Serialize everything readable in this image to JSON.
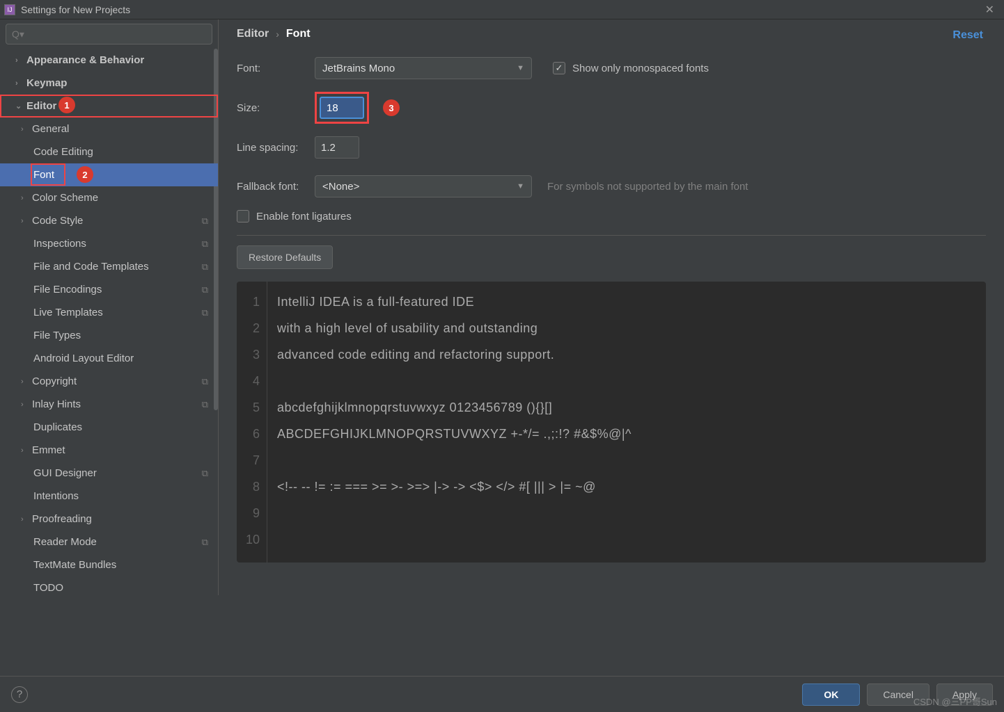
{
  "titlebar": {
    "title": "Settings for New Projects",
    "app_glyph": "IJ"
  },
  "search": {
    "placeholder": "Q▾"
  },
  "sidebar": {
    "items": [
      {
        "label": "Appearance & Behavior",
        "level": 1,
        "expandable": false
      },
      {
        "label": "Keymap",
        "level": 1,
        "expandable": false
      },
      {
        "label": "Editor",
        "level": 1,
        "expandable": true,
        "expanded": true,
        "highlight": "editor"
      },
      {
        "label": "General",
        "level": 2,
        "expandable": true
      },
      {
        "label": "Code Editing",
        "level": 2
      },
      {
        "label": "Font",
        "level": 2,
        "selected": true,
        "highlight": "font"
      },
      {
        "label": "Color Scheme",
        "level": 2,
        "expandable": true
      },
      {
        "label": "Code Style",
        "level": 2,
        "expandable": true,
        "copy": true
      },
      {
        "label": "Inspections",
        "level": 2,
        "copy": true
      },
      {
        "label": "File and Code Templates",
        "level": 2,
        "copy": true
      },
      {
        "label": "File Encodings",
        "level": 2,
        "copy": true
      },
      {
        "label": "Live Templates",
        "level": 2,
        "copy": true
      },
      {
        "label": "File Types",
        "level": 2
      },
      {
        "label": "Android Layout Editor",
        "level": 2
      },
      {
        "label": "Copyright",
        "level": 2,
        "expandable": true,
        "copy": true
      },
      {
        "label": "Inlay Hints",
        "level": 2,
        "expandable": true,
        "copy": true
      },
      {
        "label": "Duplicates",
        "level": 2
      },
      {
        "label": "Emmet",
        "level": 2,
        "expandable": true
      },
      {
        "label": "GUI Designer",
        "level": 2,
        "copy": true
      },
      {
        "label": "Intentions",
        "level": 2
      },
      {
        "label": "Proofreading",
        "level": 2,
        "expandable": true
      },
      {
        "label": "Reader Mode",
        "level": 2,
        "copy": true
      },
      {
        "label": "TextMate Bundles",
        "level": 2
      },
      {
        "label": "TODO",
        "level": 2
      }
    ]
  },
  "breadcrumb": {
    "part1": "Editor",
    "part2": "Font"
  },
  "reset": "Reset",
  "form": {
    "font_label": "Font:",
    "font_value": "JetBrains Mono",
    "mono_label": "Show only monospaced fonts",
    "size_label": "Size:",
    "size_value": "18",
    "spacing_label": "Line spacing:",
    "spacing_value": "1.2",
    "fallback_label": "Fallback font:",
    "fallback_value": "<None>",
    "fallback_hint": "For symbols not supported by the main font",
    "ligatures_label": "Enable font ligatures",
    "restore": "Restore Defaults"
  },
  "preview": {
    "lines": [
      "IntelliJ IDEA is a full-featured IDE",
      "with a high level of usability and outstanding",
      "advanced code editing and refactoring support.",
      "",
      "abcdefghijklmnopqrstuvwxyz 0123456789 (){}[]",
      "ABCDEFGHIJKLMNOPQRSTUVWXYZ +-*/= .,;:!? #&$%@|^",
      "",
      "<!-- -- != := === >= >- >=> |-> -> <$> </> #[ ||| > |= ~@",
      "",
      ""
    ]
  },
  "footer": {
    "ok": "OK",
    "cancel": "Cancel",
    "apply": "Apply"
  },
  "annotations": {
    "a1": "1",
    "a2": "2",
    "a3": "3"
  },
  "watermark": "CSDN @三PP哥Sun"
}
